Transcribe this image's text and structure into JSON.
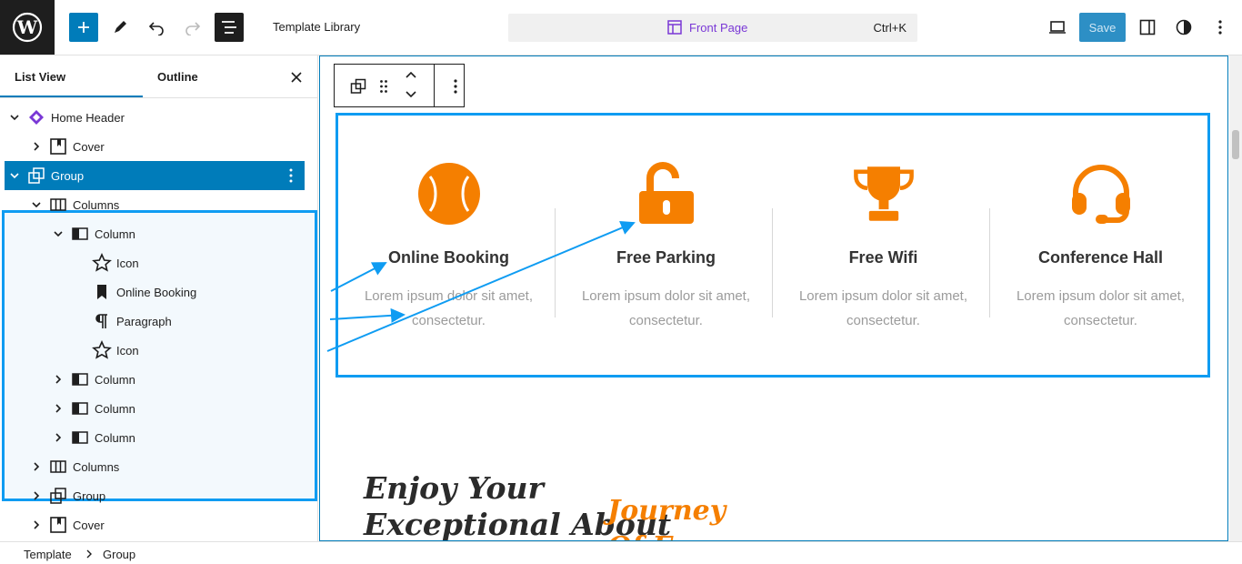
{
  "topbar": {
    "title": "Template Library",
    "command_page": "Front Page",
    "command_shortcut": "Ctrl+K",
    "save_label": "Save"
  },
  "sidebar": {
    "tab_list": "List View",
    "tab_outline": "Outline",
    "tree": [
      {
        "label": "Home Header",
        "icon": "template-part-icon",
        "indent": 0,
        "expanded": true
      },
      {
        "label": "Cover",
        "icon": "cover-icon",
        "indent": 1,
        "expanded": false
      },
      {
        "label": "Group",
        "icon": "group-icon",
        "indent": 0,
        "expanded": true,
        "selected": true
      },
      {
        "label": "Columns",
        "icon": "columns-icon",
        "indent": 1,
        "expanded": true
      },
      {
        "label": "Column",
        "icon": "column-icon",
        "indent": 2,
        "expanded": true
      },
      {
        "label": "Icon",
        "icon": "star-icon",
        "indent": 3
      },
      {
        "label": "Online Booking",
        "icon": "bookmark-icon",
        "indent": 3
      },
      {
        "label": "Paragraph",
        "icon": "paragraph-icon",
        "indent": 3
      },
      {
        "label": "Icon",
        "icon": "star-icon",
        "indent": 3
      },
      {
        "label": "Column",
        "icon": "column-icon",
        "indent": 2,
        "expanded": false
      },
      {
        "label": "Column",
        "icon": "column-icon",
        "indent": 2,
        "expanded": false
      },
      {
        "label": "Column",
        "icon": "column-icon",
        "indent": 2,
        "expanded": false
      },
      {
        "label": "Columns",
        "icon": "columns-icon",
        "indent": 1,
        "expanded": false
      },
      {
        "label": "Group",
        "icon": "group-icon",
        "indent": 1,
        "expanded": false
      },
      {
        "label": "Cover",
        "icon": "cover-icon",
        "indent": 1,
        "expanded": false
      }
    ]
  },
  "canvas": {
    "features": [
      {
        "title": "Online Booking",
        "text": "Lorem ipsum dolor sit amet, consectetur.",
        "icon": "baseball-icon"
      },
      {
        "title": "Free Parking",
        "text": "Lorem ipsum dolor sit amet, consectetur.",
        "icon": "unlock-icon"
      },
      {
        "title": "Free Wifi",
        "text": "Lorem ipsum dolor sit amet, consectetur.",
        "icon": "trophy-icon"
      },
      {
        "title": "Conference Hall",
        "text": "Lorem ipsum dolor sit amet, consectetur.",
        "icon": "headset-icon"
      }
    ],
    "heading_line1": "Enjoy Your",
    "heading_line2": "Exceptional About",
    "accent_line1": "Journey",
    "accent_line2": "Of Ex"
  },
  "breadcrumb": {
    "items": [
      "Template",
      "Group"
    ]
  },
  "colors": {
    "accent": "#007cba",
    "highlight": "#0f9cf2",
    "orange": "#f57f00"
  }
}
